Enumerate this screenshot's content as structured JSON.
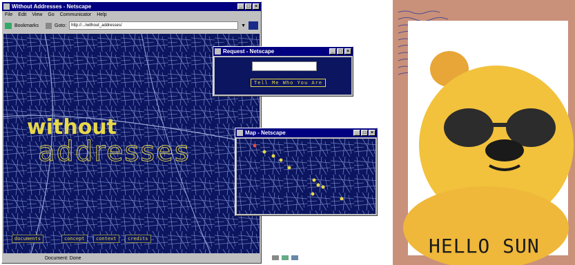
{
  "main_window": {
    "title": "Without Addresses - Netscape",
    "menu": [
      "File",
      "Edit",
      "View",
      "Go",
      "Communicator",
      "Help"
    ],
    "toolbar": {
      "bookmarks_label": "Bookmarks",
      "goto_label": "Goto:",
      "url": "http://.../without_addresses/"
    },
    "headline_1": "without",
    "headline_2": "addresses",
    "nav": [
      "documents",
      "concept",
      "context",
      "credits"
    ],
    "status": "Document: Done"
  },
  "request_window": {
    "title": "Request - Netscape",
    "input_value": "",
    "button_label": "Tell Me Who You Are"
  },
  "map_window": {
    "title": "Map - Netscape"
  },
  "poster": {
    "caption": "HELLO SUN"
  },
  "colors": {
    "map_bg": "#0b1560",
    "accent_yellow": "#e6d84a",
    "poster_bg": "#c9907a"
  }
}
